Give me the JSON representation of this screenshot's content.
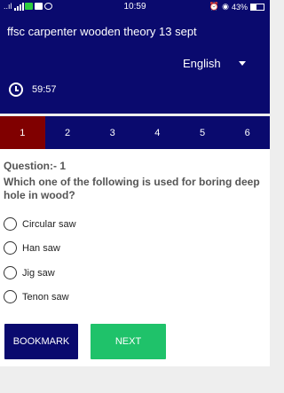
{
  "status_bar": {
    "signal_text": "..ıl",
    "time": "10:59",
    "battery_text": "43%",
    "battery_level": 0.43
  },
  "header": {
    "title": "ffsc carpenter wooden theory  13 sept",
    "language": "English",
    "timer": "59:57"
  },
  "tabs": [
    {
      "label": "1",
      "active": true
    },
    {
      "label": "2",
      "active": false
    },
    {
      "label": "3",
      "active": false
    },
    {
      "label": "4",
      "active": false
    },
    {
      "label": "5",
      "active": false
    },
    {
      "label": "6",
      "active": false
    }
  ],
  "question": {
    "label": "Question:- 1",
    "text": "Which one of the following is used for boring deep hole in wood?"
  },
  "options": [
    "Circular saw",
    "Han saw",
    "Jig saw",
    "Tenon saw"
  ],
  "buttons": {
    "bookmark": "BOOKMARK",
    "next": "NEXT"
  },
  "colors": {
    "header_bg": "#0a0a6e",
    "active_tab": "#800000",
    "next_button": "#1fc26a"
  }
}
